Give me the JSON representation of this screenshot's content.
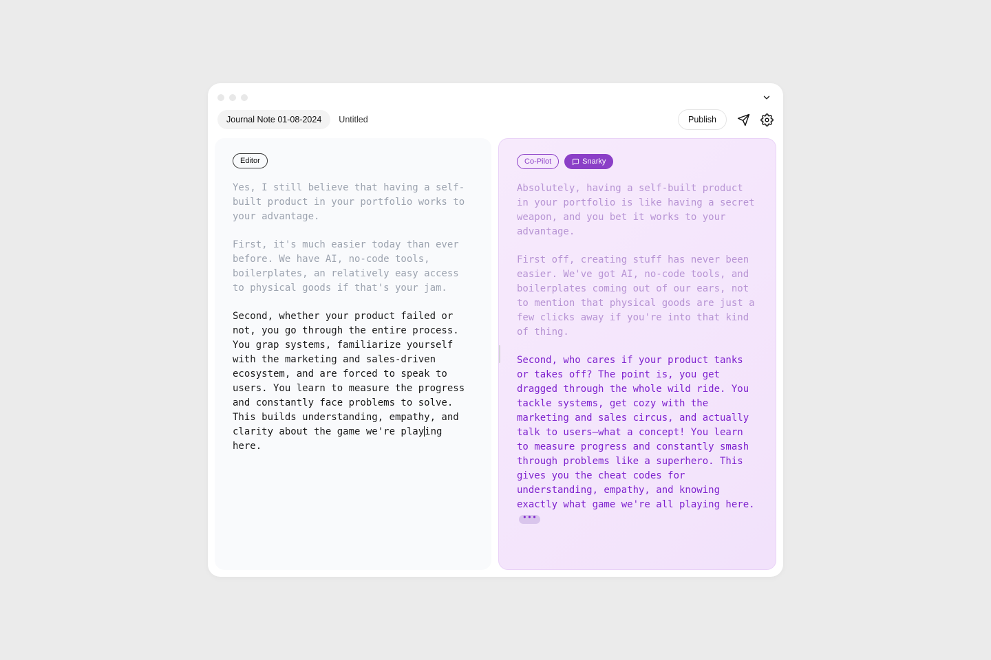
{
  "header": {
    "tab_active": "Journal Note 01-08-2024",
    "tab_secondary": "Untitled",
    "publish_label": "Publish"
  },
  "editor": {
    "badge": "Editor",
    "p1": "Yes, I still believe that having a self-built product in your portfolio works to your advantage.",
    "p2": "First, it's much easier today than ever before. We have AI, no-code tools, boilerplates, an relatively easy access to physical goods if that's your jam.",
    "p3_before": "Second, whether your product failed or not, you go through the entire process. You grap systems, familiarize yourself with the marketing and sales-driven ecosystem, and are forced to speak to users. You learn to measure the progress and constantly face problems to solve. This builds understanding, empathy, and clarity about the game we're play",
    "p3_cursor_char": "i",
    "p3_after": "ng here."
  },
  "copilot": {
    "badge": "Co-Pilot",
    "tone_badge": "Snarky",
    "p1": "Absolutely, having a self-built product in your portfolio is like having a secret weapon, and you bet it works to your advantage.",
    "p2": "First off, creating stuff has never been easier. We've got AI, no-code tools, and boilerplates coming out of our ears, not to mention that physical goods are just a few clicks away if you're into that kind of thing.",
    "p3": "Second, who cares if your product tanks or takes off? The point is, you get dragged through the whole wild ride. You tackle systems, get cozy with the marketing and sales circus, and actually talk to users—what a concept! You learn to measure progress and constantly smash through problems like a superhero. This gives you the cheat codes for understanding, empathy, and knowing exactly what game we're all playing here."
  }
}
